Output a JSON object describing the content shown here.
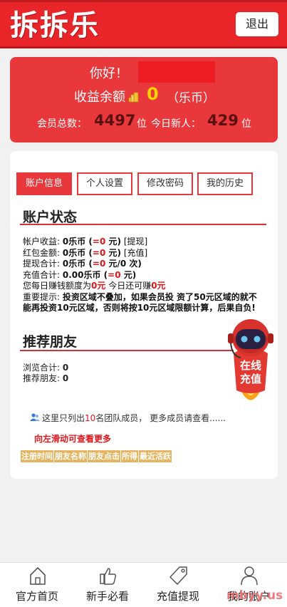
{
  "header": {
    "logo": "拆拆乐",
    "logout_label": "退出"
  },
  "info": {
    "greeting": "你好！",
    "balance_label": "收益余额",
    "balance_value": "0",
    "balance_unit": "（乐币）",
    "members_label": "会员总数：",
    "members_value": "4497",
    "members_unit": "位",
    "new_today_label": "今日新人：",
    "new_today_value": "429",
    "new_today_unit": "位"
  },
  "tabs": [
    {
      "label": "账户信息",
      "active": true
    },
    {
      "label": "个人设置",
      "active": false
    },
    {
      "label": "修改密码",
      "active": false
    },
    {
      "label": "我的历史",
      "active": false
    }
  ],
  "account": {
    "title": "账户状态",
    "income_label": "帐户收益: ",
    "income_value": "0乐币",
    "income_eq": "=0",
    "income_unit": "元)",
    "income_link": "[提现]",
    "redpack_label": "红包金额: ",
    "redpack_value": "0乐币",
    "redpack_eq": "=0",
    "redpack_unit": "元)",
    "redpack_link": "[充值]",
    "withdraw_label": "提现合计: ",
    "withdraw_value": "0乐币",
    "withdraw_eq": "=0",
    "withdraw_unit": "元/0 次)",
    "recharge_label": "充值合计: ",
    "recharge_value": "0.00乐币",
    "recharge_eq": "=0",
    "recharge_unit": "元)",
    "daily_a": "您每日赚钱额度为",
    "daily_b": "0元",
    "daily_c": " 今日还可赚",
    "daily_d": "0元",
    "notice_label": "重要提示: ",
    "notice_text": "投资区域不叠加，如果会员投 资了50元区域的就不能再投资10元区域，否则将按10元区域限额计算，后果自负!"
  },
  "friends": {
    "title": "推荐朋友",
    "views_label": "浏览合计: ",
    "views_value": "0",
    "referrals_label": "推荐朋友: ",
    "referrals_value": "0",
    "member_note_a": "这里只列出",
    "member_note_b": "10",
    "member_note_c": "名团队成员， 更多成员请查看......",
    "swipe_tip": "向左滑动可查看更多",
    "columns": [
      "注册时间",
      "朋友名称",
      "朋友点击",
      "所得",
      "最近活跃"
    ]
  },
  "robot": {
    "line1": "在线",
    "line2": "充值"
  },
  "bottom_nav": [
    {
      "label": "官方首页",
      "icon": "home-icon"
    },
    {
      "label": "新手必看",
      "icon": "thumbs-up-icon"
    },
    {
      "label": "充值提现",
      "icon": "tag-icon"
    },
    {
      "label": "我的账户",
      "icon": "user-icon"
    }
  ],
  "watermark": "mbyy.us",
  "colors": {
    "primary_red": "#e8383c",
    "header_red": "#e8262a",
    "gold": "#ffd200",
    "table_header": "#e6b45e"
  }
}
